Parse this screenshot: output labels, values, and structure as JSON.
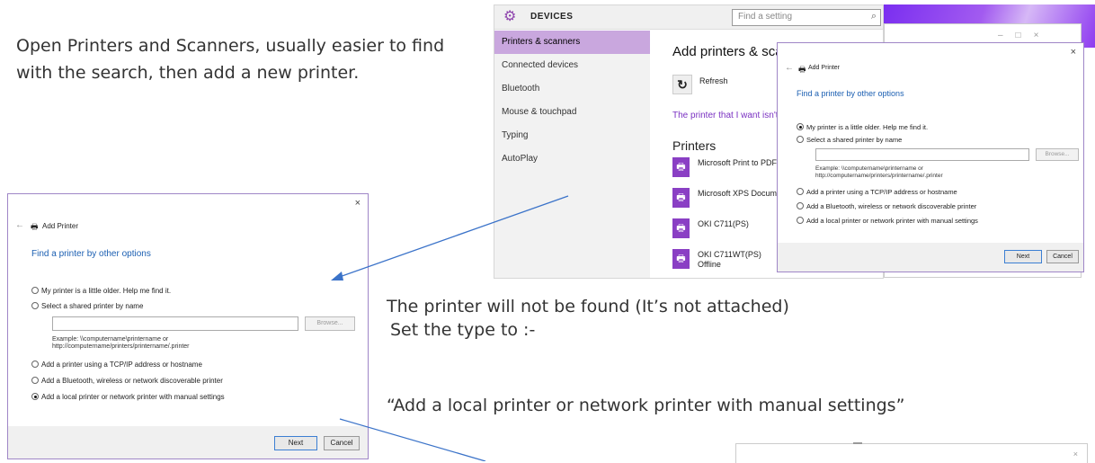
{
  "instructions": {
    "step1": "Open Printers and Scanners, usually easier to find with the search, then add a new printer.",
    "step2_line1": "The printer will not be found (It’s not attached)",
    "step2_line2": "Set the type to :-",
    "step3": "“Add a local printer or network printer with manual settings”"
  },
  "settings": {
    "title": "DEVICES",
    "search_placeholder": "Find a setting",
    "sidebar": [
      {
        "label": "Printers & scanners",
        "active": true
      },
      {
        "label": "Connected devices"
      },
      {
        "label": "Bluetooth"
      },
      {
        "label": "Mouse & touchpad"
      },
      {
        "label": "Typing"
      },
      {
        "label": "AutoPlay"
      }
    ],
    "heading": "Add printers & scann",
    "refresh_label": "Refresh",
    "not_listed_link": "The printer that I want isn't liste",
    "printers_heading": "Printers",
    "printers": [
      {
        "name": "Microsoft Print to PDF",
        "status": ""
      },
      {
        "name": "Microsoft XPS Documen",
        "status": ""
      },
      {
        "name": "OKI C711(PS)",
        "status": ""
      },
      {
        "name": "OKI C711WT(PS)",
        "status": "Offline"
      }
    ]
  },
  "dialog": {
    "title": "Add Printer",
    "heading": "Find a printer by other options",
    "options": [
      "My printer is a little older. Help me find it.",
      "Select a shared printer by name",
      "Add a printer using a TCP/IP address or hostname",
      "Add a Bluetooth, wireless or network discoverable printer",
      "Add a local printer or network printer with manual settings"
    ],
    "browse_label": "Browse...",
    "example_line1": "Example: \\\\computername\\printername or",
    "example_line2": "http://computername/printers/printername/.printer",
    "next_label": "Next",
    "cancel_label": "Cancel",
    "close_glyph": "×",
    "back_glyph": "←"
  },
  "accent_colors": {
    "purple": "#8a3fc4",
    "link_blue": "#1b5fb2",
    "arrow": "#3b73c9"
  }
}
